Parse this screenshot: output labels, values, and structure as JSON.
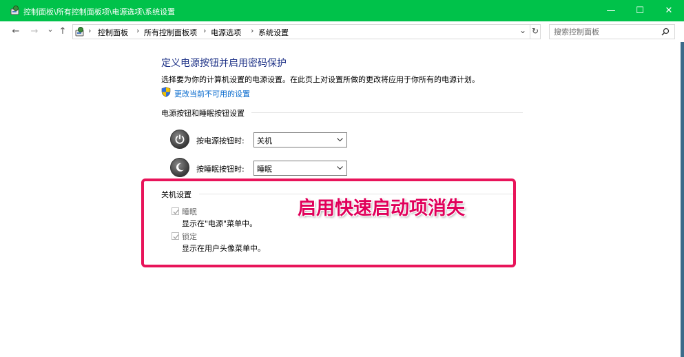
{
  "window": {
    "title": "控制面板\\所有控制面板项\\电源选项\\系统设置",
    "minimize_glyph": "—",
    "maximize_glyph": "☐",
    "close_glyph": "✕"
  },
  "nav": {
    "back_glyph": "←",
    "forward_glyph": "→",
    "recent_glyph": "⌄",
    "up_glyph": "↑",
    "breadcrumbs": [
      "控制面板",
      "所有控制面板项",
      "电源选项",
      "系统设置"
    ],
    "breadcrumb_sep": "›",
    "dropdown_glyph": "⌄",
    "refresh_glyph": "↻",
    "search_placeholder": "搜索控制面板",
    "search_icon_glyph": "⚲"
  },
  "content": {
    "heading": "定义电源按钮并启用密码保护",
    "description": "选择要为你的计算机设置的电源设置。在此页上对设置所做的更改将应用于你所有的电源计划。",
    "change_link": "更改当前不可用的设置",
    "buttons_section": {
      "title": "电源按钮和睡眠按钮设置",
      "rows": [
        {
          "label": "按电源按钮时:",
          "value": "关机"
        },
        {
          "label": "按睡眠按钮时:",
          "value": "睡眠"
        }
      ]
    },
    "shutdown_section": {
      "title": "关机设置",
      "items": [
        {
          "label": "睡眠",
          "description": "显示在\"电源\"菜单中。",
          "checked": true
        },
        {
          "label": "锁定",
          "description": "显示在用户头像菜单中。",
          "checked": true
        }
      ]
    }
  },
  "annotation": {
    "text": "启用快速启动项消失",
    "color": "#e8145a"
  },
  "colors": {
    "titlebar": "#00c24a",
    "heading": "#1e3287",
    "link": "#0066cc"
  }
}
